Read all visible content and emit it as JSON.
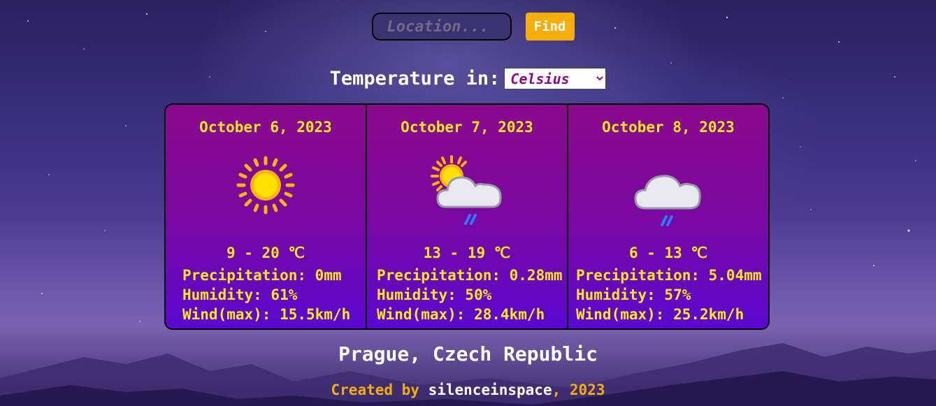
{
  "search": {
    "placeholder": "Location...",
    "value": "",
    "button_label": "Find"
  },
  "units": {
    "label": "Temperature in:",
    "selected": "Celsius",
    "options": [
      "Celsius"
    ]
  },
  "forecast": [
    {
      "date": "October 6, 2023",
      "icon": "sun-icon",
      "temp_range": "9 - 20 ℃",
      "precipitation": "Precipitation: 0mm",
      "humidity": "Humidity: 61%",
      "wind": "Wind(max): 15.5km/h"
    },
    {
      "date": "October 7, 2023",
      "icon": "sun-cloud-rain-icon",
      "temp_range": "13 - 19 ℃",
      "precipitation": "Precipitation: 0.28mm",
      "humidity": "Humidity: 50%",
      "wind": "Wind(max): 28.4km/h"
    },
    {
      "date": "October 8, 2023",
      "icon": "cloud-rain-icon",
      "temp_range": "6 - 13 ℃",
      "precipitation": "Precipitation: 5.04mm",
      "humidity": "Humidity: 57%",
      "wind": "Wind(max): 25.2km/h"
    }
  ],
  "location_title": "Prague, Czech Republic",
  "credits": {
    "prefix": "Created by ",
    "author": "silenceinspace",
    "suffix": ", 2023"
  },
  "colors": {
    "accent": "#f5ad0a",
    "card_text": "#ffe81a",
    "card_top": "#8a0a8c",
    "card_bottom": "#5a08d0"
  }
}
